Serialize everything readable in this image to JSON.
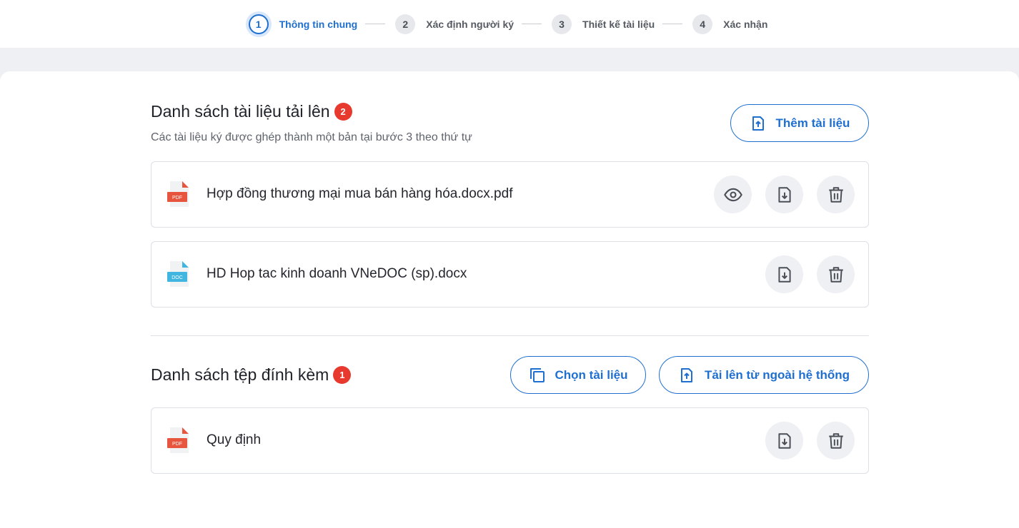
{
  "stepper": {
    "steps": [
      {
        "num": "1",
        "label": "Thông tin chung"
      },
      {
        "num": "2",
        "label": "Xác định người ký"
      },
      {
        "num": "3",
        "label": "Thiết kế tài liệu"
      },
      {
        "num": "4",
        "label": "Xác nhận"
      }
    ],
    "active_step": 1
  },
  "documents": {
    "title": "Danh sách tài liệu tải lên",
    "count": "2",
    "subtitle": "Các tài liệu ký được ghép thành một bản tại bước 3 theo thứ tự",
    "add_button": "Thêm tài liệu",
    "files": [
      {
        "name": "Hợp đồng thương mại mua bán hàng hóa.docx.pdf",
        "type": "PDF",
        "icon": "pdf-file-icon"
      },
      {
        "name": "HD Hop tac kinh doanh VNeDOC (sp).docx",
        "type": "DOC",
        "icon": "doc-file-icon"
      }
    ]
  },
  "attachments": {
    "title": "Danh sách tệp đính kèm",
    "count": "1",
    "choose_button": "Chọn tài liệu",
    "upload_button": "Tải lên từ ngoài hệ thống",
    "files": [
      {
        "name": "Quy định",
        "type": "PDF",
        "icon": "pdf-file-icon"
      }
    ]
  },
  "colors": {
    "accent": "#1f6fd1",
    "badge": "#e8392f",
    "pdf": "#e8553f",
    "doc": "#3fb5e0"
  },
  "icons": [
    "eye-icon",
    "download-icon",
    "trash-icon",
    "upload-icon",
    "copy-icon"
  ]
}
